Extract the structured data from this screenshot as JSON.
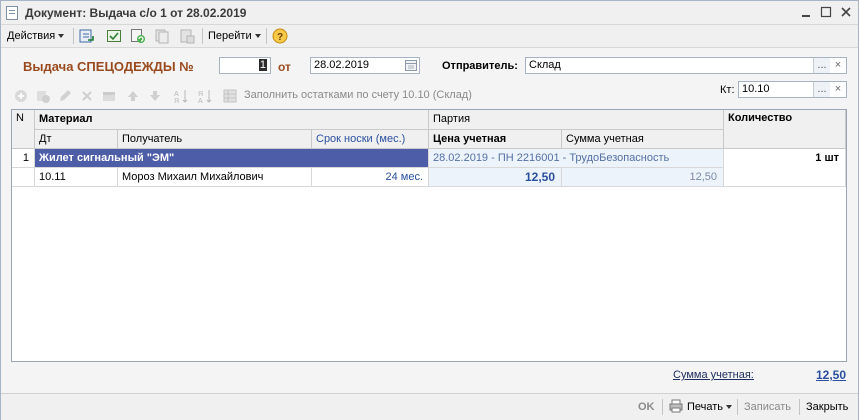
{
  "window": {
    "title": "Документ: Выдача с/о 1 от 28.02.2019"
  },
  "toolbar": {
    "actions_label": "Действия",
    "goto_label": "Перейти",
    "help_glyph": "?"
  },
  "header": {
    "doc_label": "Выдача СПЕЦОДЕЖДЫ №",
    "doc_number": "1",
    "from_label": "от",
    "date": "28.02.2019",
    "sender_label": "Отправитель:",
    "sender_value": "Склад",
    "kt_label": "Кт:",
    "kt_value": "10.10",
    "ellipsis": "...",
    "clear_glyph": "×"
  },
  "table_toolbar": {
    "fill_label": "Заполнить остатками по счету 10.10 (Склад)"
  },
  "table": {
    "headers": {
      "n": "N",
      "material": "Материал",
      "dt": "Дт",
      "recipient": "Получатель",
      "wear_period": "Срок носки (мес.)",
      "batch": "Партия",
      "price": "Цена учетная",
      "sum": "Сумма учетная",
      "quantity": "Количество"
    },
    "rows": [
      {
        "n": "1",
        "material": "Жилет сигнальный \"ЭМ\"",
        "batch": "28.02.2019 - ПН 2216001 - ТрудоБезопасность",
        "quantity": "1 шт",
        "dt": "10.11",
        "recipient": "Мороз Михаил Михайлович",
        "wear_period": "24 мес.",
        "price": "12,50",
        "sum": "12,50"
      }
    ]
  },
  "footer": {
    "sum_label": "Сумма учетная:",
    "sum_value": "12,50"
  },
  "bottom": {
    "ok": "OK",
    "print": "Печать",
    "save": "Записать",
    "close": "Закрыть"
  },
  "colors": {
    "accent_orange": "#9a4a1e",
    "selection": "#4d5da8",
    "link_blue": "#2a4fa0"
  },
  "icons": [
    "document-icon",
    "minimize-icon",
    "maximize-icon",
    "close-icon",
    "help-icon"
  ]
}
